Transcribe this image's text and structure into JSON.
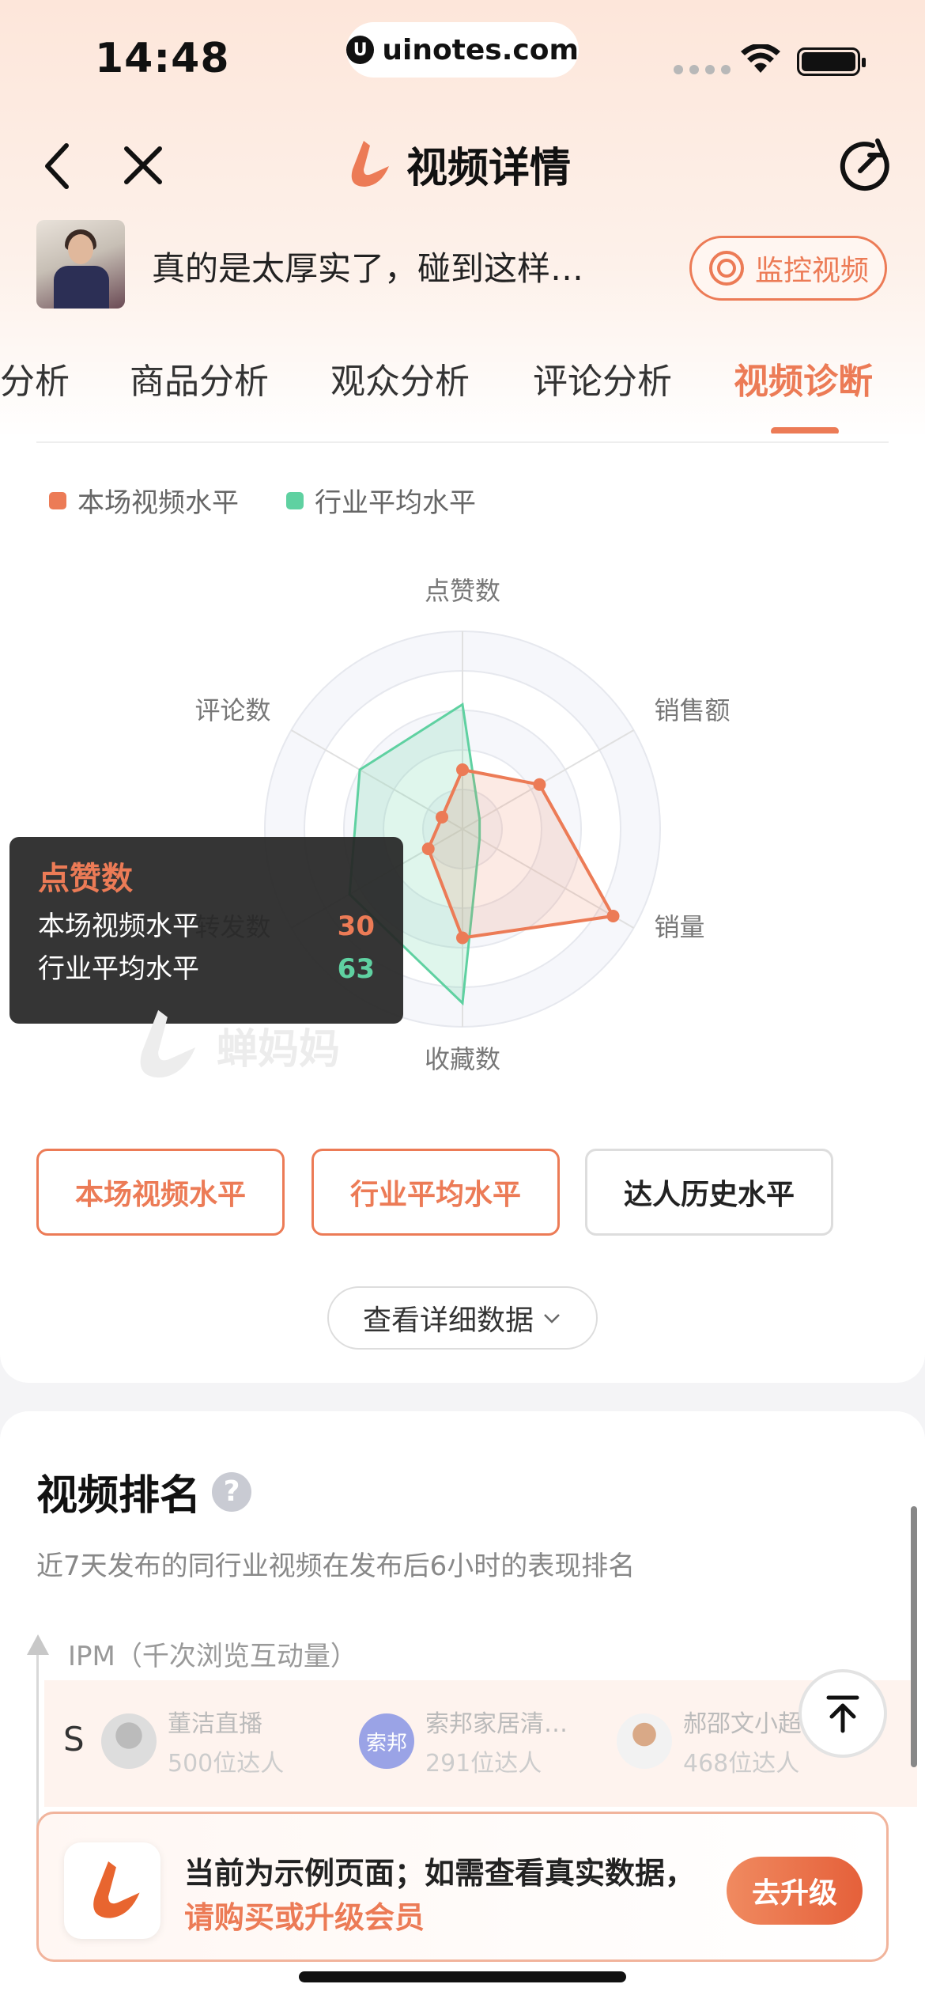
{
  "status_bar": {
    "time": "14:48",
    "url": "uinotes.com"
  },
  "nav": {
    "title": "视频详情"
  },
  "video": {
    "title": "真的是太厚实了，碰到这样…",
    "monitor_label": "监控视频"
  },
  "tabs": [
    {
      "label": "分析"
    },
    {
      "label": "商品分析"
    },
    {
      "label": "观众分析"
    },
    {
      "label": "评论分析"
    },
    {
      "label": "视频诊断",
      "active": true
    }
  ],
  "legend": {
    "current": "本场视频水平",
    "industry": "行业平均水平"
  },
  "colors": {
    "accent": "#ec7b56",
    "industry": "#5fd1a1"
  },
  "chart_data": {
    "type": "radar",
    "categories": [
      "点赞数",
      "销售额",
      "销量",
      "收藏数",
      "转发数",
      "评论数"
    ],
    "series": [
      {
        "name": "本场视频水平",
        "values": [
          30,
          45,
          88,
          55,
          20,
          12
        ]
      },
      {
        "name": "行业平均水平",
        "values": [
          63,
          10,
          10,
          88,
          66,
          60
        ]
      }
    ],
    "max": 100
  },
  "tooltip": {
    "title": "点赞数",
    "rows": [
      {
        "label": "本场视频水平",
        "value": "30"
      },
      {
        "label": "行业平均水平",
        "value": "63"
      }
    ]
  },
  "watermark": "蝉妈妈",
  "mode_buttons": [
    "本场视频水平",
    "行业平均水平",
    "达人历史水平"
  ],
  "detail_button": "查看详细数据",
  "ranking": {
    "title": "视频排名",
    "subtitle": "近7天发布的同行业视频在发布后6小时的表现排名",
    "axis_label": "IPM（千次浏览互动量）",
    "grade": "S",
    "entries": [
      {
        "name": "董洁直播",
        "count": "500位达人"
      },
      {
        "name": "索邦家居清…",
        "count": "291位达人",
        "avatar_text": "索邦"
      },
      {
        "name": "郝邵文小超",
        "count": "468位达人"
      }
    ]
  },
  "upgrade": {
    "line1": "当前为示例页面；如需查看真实数据，",
    "line2": "请购买或升级会员",
    "button": "去升级"
  }
}
